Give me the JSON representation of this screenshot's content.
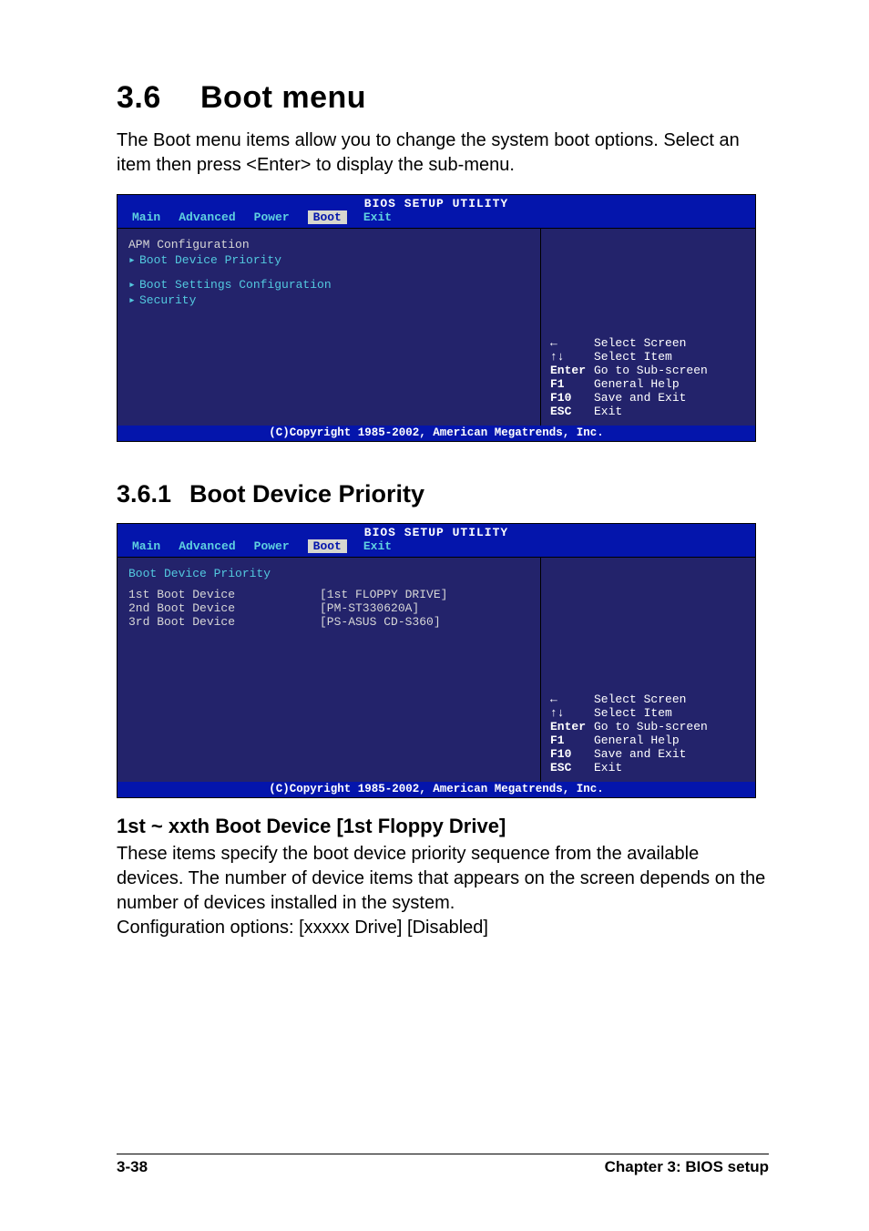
{
  "heading": {
    "num": "3.6",
    "title": "Boot menu"
  },
  "intro": "The Boot menu items allow you to change the system boot options. Select an item then press <Enter> to display the sub-menu.",
  "bios_common": {
    "title": "BIOS SETUP UTILITY",
    "tabs": {
      "main": "Main",
      "advanced": "Advanced",
      "power": "Power",
      "boot": "Boot",
      "exit": "Exit"
    },
    "help": {
      "left_arrow": "←",
      "updown": "↑↓",
      "rows": [
        {
          "k": "←",
          "d": "Select Screen"
        },
        {
          "k": "↑↓",
          "d": "Select Item"
        },
        {
          "k": "Enter",
          "d": "Go to Sub-screen"
        },
        {
          "k": "F1",
          "d": "General Help"
        },
        {
          "k": "F10",
          "d": "Save and Exit"
        },
        {
          "k": "ESC",
          "d": "Exit"
        }
      ]
    },
    "footer": "(C)Copyright 1985-2002, American Megatrends, Inc."
  },
  "bios1": {
    "left": {
      "top": "APM Configuration",
      "items": [
        "Boot Device Priority",
        "Boot Settings Configuration",
        "Security"
      ]
    }
  },
  "sub": {
    "num": "3.6.1",
    "title": "Boot Device Priority"
  },
  "bios2": {
    "left": {
      "header": "Boot Device Priority",
      "rows": [
        {
          "k": "1st Boot Device",
          "v": "[1st FLOPPY DRIVE]"
        },
        {
          "k": "2nd Boot Device",
          "v": "[PM-ST330620A]"
        },
        {
          "k": "3rd Boot Device",
          "v": "[PS-ASUS CD-S360]"
        }
      ]
    }
  },
  "opt": {
    "title": "1st ~ xxth Boot Device [1st Floppy Drive]",
    "p1": "These items specify the boot device priority sequence from the available devices. The number of device items that appears on the screen depends on the number of devices installed in the system.",
    "p2": "Configuration options: [xxxxx Drive] [Disabled]"
  },
  "footer": {
    "left": "3-38",
    "right": "Chapter 3: BIOS setup"
  }
}
